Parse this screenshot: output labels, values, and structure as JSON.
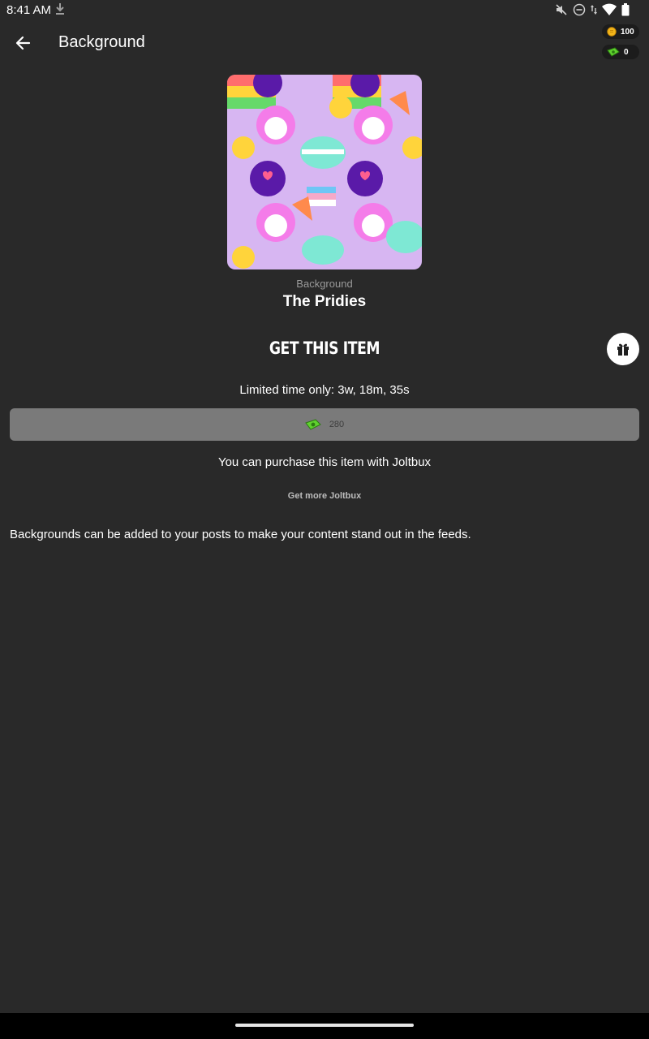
{
  "status_bar": {
    "time": "8:41 AM"
  },
  "app_bar": {
    "title": "Background"
  },
  "currency": {
    "coins": "100",
    "joltbux": "0"
  },
  "item": {
    "type_label": "Background",
    "name": "The Pridies"
  },
  "purchase": {
    "heading": "GET THIS ITEM",
    "limited_time": "Limited time only: 3w, 18m, 35s",
    "price": "280",
    "purchase_info": "You can purchase this item with Joltbux",
    "get_more_link": "Get more Joltbux"
  },
  "description": "Backgrounds can be added to your posts to make your content stand out in the feeds.",
  "colors": {
    "background": "#292929",
    "button_disabled": "#7a7a7a",
    "joltbux_green": "#5fd12e",
    "coin_gold": "#f2b51b"
  },
  "icons": {
    "back": "arrow-left-icon",
    "gift": "gift-icon",
    "coin": "coin-icon",
    "joltbux": "joltbux-icon"
  }
}
